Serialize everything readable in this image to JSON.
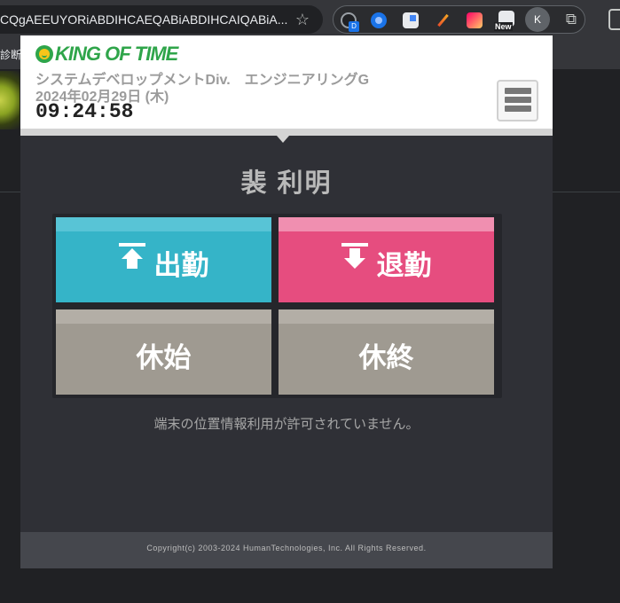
{
  "browser": {
    "url": "CQgAEEUYORiABDIHCAEQABiABDIHCAIQABiA...",
    "new_badge": "New",
    "profile_initial": "K",
    "bookmark_label": "診断",
    "ext1_badge": "D"
  },
  "app": {
    "logo_text": "KING OF TIME",
    "org": "システムデベロップメントDiv.　エンジニアリングG",
    "date": "2024年02月29日 (木)",
    "time": "09:24:58",
    "user_name": "裴 利明",
    "buttons": {
      "clock_in": "出勤",
      "clock_out": "退勤",
      "break_start": "休始",
      "break_end": "休終"
    },
    "notice": "端末の位置情報利用が許可されていません。",
    "copyright": "Copyright(c) 2003-2024 HumanTechnologies, Inc. All Rights Reserved."
  },
  "colors": {
    "clock_in": "#35b4c8",
    "clock_out": "#e64d7f",
    "break": "#9f9a91",
    "brand_green": "#2fa54a"
  },
  "icons": {
    "star": "star-icon",
    "menu": "hamburger-menu-icon",
    "clock_in": "arrow-up-icon",
    "clock_out": "arrow-down-icon"
  }
}
